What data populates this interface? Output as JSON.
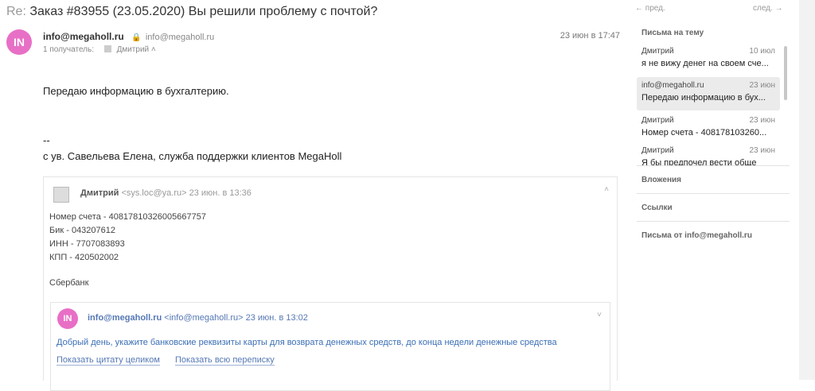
{
  "subject": {
    "prefix": "Re:",
    "text": "Заказ #83955 (23.05.2020) Вы решили проблему с почтой?"
  },
  "message": {
    "avatar": "IN",
    "sender_name": "info@megaholl.ru",
    "sender_email": "info@megaholl.ru",
    "date": "23 июн в 17:47",
    "recipients_label": "1 получатель:",
    "recipient": "Дмитрий",
    "body": "Передаю информацию в бухгалтерию.",
    "signature_sep": "--",
    "signature": "с ув. Савельева Елена, служба поддержки клиентов MegaHoll"
  },
  "quote1": {
    "sender_name": "Дмитрий",
    "sender_email": "<sys.loc@ya.ru>",
    "date": "23 июн. в 13:36",
    "lines": [
      "Номер счета - 40817810326005667757",
      "Бик - 043207612",
      "ИНН - 7707083893",
      "КПП - 420502002"
    ],
    "bank": "Сбербанк"
  },
  "quote2": {
    "avatar": "IN",
    "sender_name": "info@megaholl.ru",
    "sender_email": "<info@megaholl.ru>",
    "date": "23 июн. в 13:02",
    "text": "Добрый день, укажите банковские реквизиты карты для возврата денежных средств, до конца недели денежные средства",
    "link_full_quote": "Показать цитату целиком",
    "link_full_thread": "Показать всю переписку"
  },
  "sidebar": {
    "prev": "← пред.",
    "next": "след. →",
    "thread_title": "Письма на тему",
    "threads": [
      {
        "name": "Дмитрий",
        "date": "10 июл",
        "snippet": "я не вижу денег на своем сче..."
      },
      {
        "name": "info@megaholl.ru",
        "date": "23 июн",
        "snippet": "Передаю информацию в бух..."
      },
      {
        "name": "Дмитрий",
        "date": "23 июн",
        "snippet": "Номер счета - 408178103260..."
      },
      {
        "name": "Дмитрий",
        "date": "23 июн",
        "snippet": "Я бы предпочел вести обще"
      }
    ],
    "attachments": "Вложения",
    "links": "Ссылки",
    "from_sender": "Письма от info@megaholl.ru"
  },
  "colors": {
    "avatar": "#e86fc6",
    "link": "#5578b5",
    "selected": "#ebebeb"
  }
}
